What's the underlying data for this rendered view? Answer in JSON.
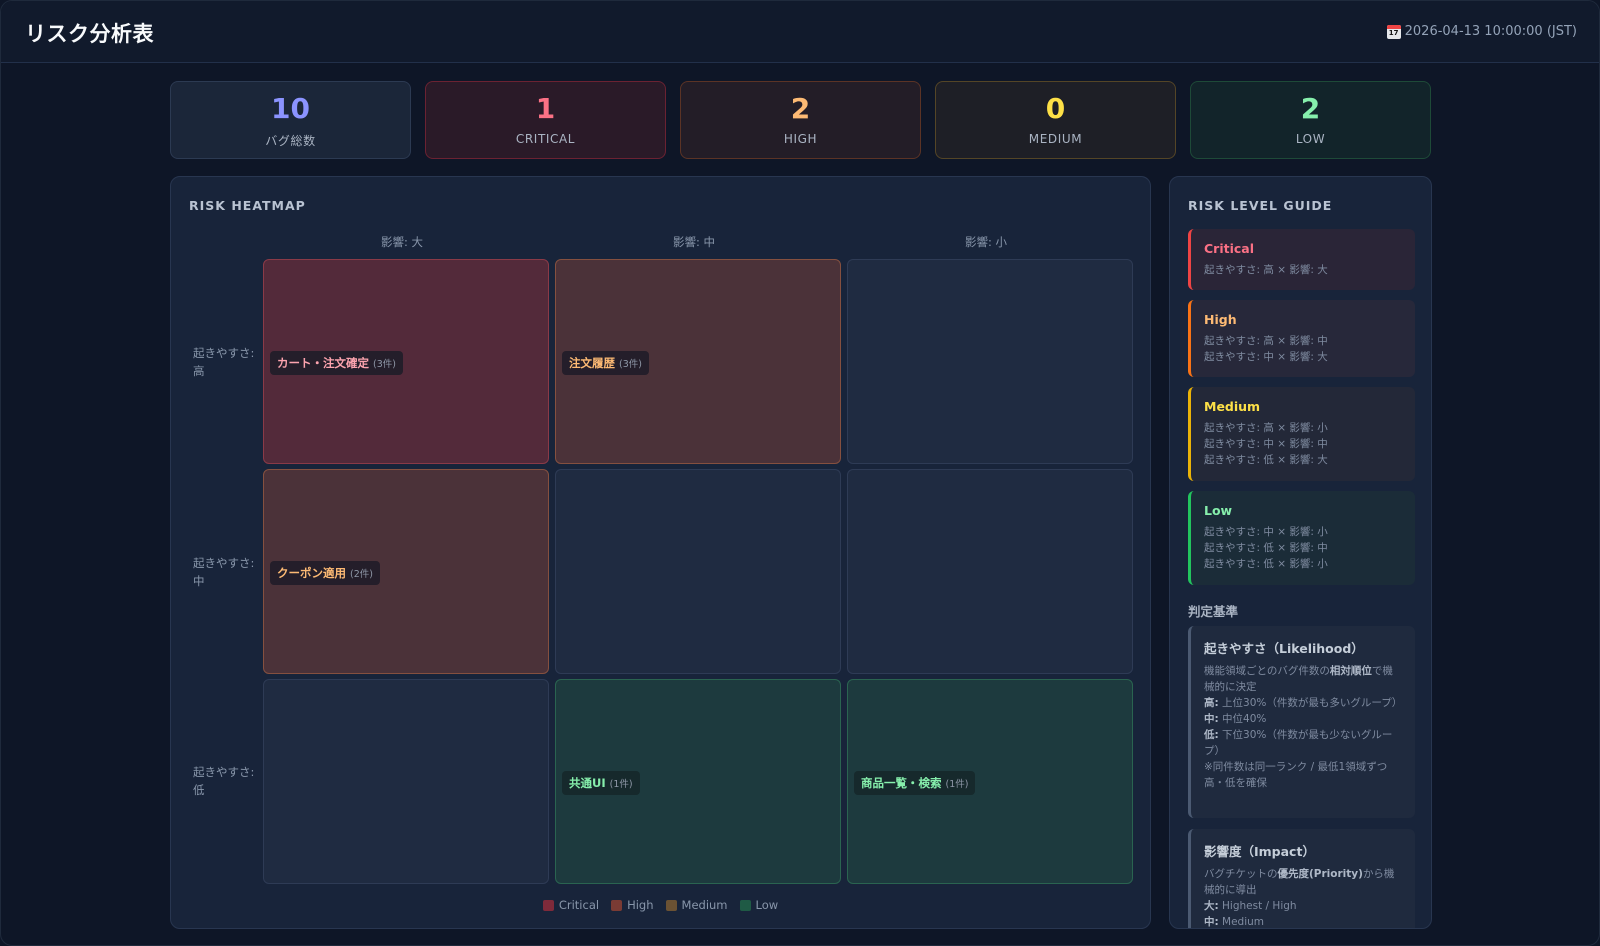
{
  "header": {
    "title": "リスク分析表",
    "timestamp": "2026-04-13 10:00:00 (JST)",
    "timestamp_icon": "calendar-icon"
  },
  "stats": {
    "total": {
      "value": "10",
      "label": "バグ総数"
    },
    "critical": {
      "value": "1",
      "label": "CRITICAL"
    },
    "high": {
      "value": "2",
      "label": "HIGH"
    },
    "medium": {
      "value": "0",
      "label": "MEDIUM"
    },
    "low": {
      "value": "2",
      "label": "LOW"
    }
  },
  "heatmap": {
    "title": "RISK HEATMAP",
    "columns": [
      "影響: 大",
      "影響: 中",
      "影響: 小"
    ],
    "rows": [
      {
        "label_1": "起きやすさ:",
        "label_2": "高"
      },
      {
        "label_1": "起きやすさ:",
        "label_2": "中"
      },
      {
        "label_1": "起きやすさ:",
        "label_2": "低"
      }
    ],
    "cells": {
      "high_large": {
        "name": "カート・注文確定",
        "count": "(3件)",
        "level": "critical"
      },
      "high_mid": {
        "name": "注文履歴",
        "count": "(3件)",
        "level": "high"
      },
      "mid_large": {
        "name": "クーポン適用",
        "count": "(2件)",
        "level": "high"
      },
      "low_mid": {
        "name": "共通UI",
        "count": "(1件)",
        "level": "low"
      },
      "low_small": {
        "name": "商品一覧・検索",
        "count": "(1件)",
        "level": "low"
      }
    },
    "legend": [
      {
        "label": "Critical",
        "color": "#7f2a3a"
      },
      {
        "label": "High",
        "color": "#7a3b34"
      },
      {
        "label": "Medium",
        "color": "#6b5233"
      },
      {
        "label": "Low",
        "color": "#1f5a45"
      }
    ]
  },
  "guide": {
    "title": "RISK LEVEL GUIDE",
    "critical": {
      "title": "Critical",
      "lines": [
        "起きやすさ: 高 × 影響: 大"
      ]
    },
    "high": {
      "title": "High",
      "lines": [
        "起きやすさ: 高 × 影響: 中",
        "起きやすさ: 中 × 影響: 大"
      ]
    },
    "medium": {
      "title": "Medium",
      "lines": [
        "起きやすさ: 高 × 影響: 小",
        "起きやすさ: 中 × 影響: 中",
        "起きやすさ: 低 × 影響: 大"
      ]
    },
    "low": {
      "title": "Low",
      "lines": [
        "起きやすさ: 中 × 影響: 小",
        "起きやすさ: 低 × 影響: 中",
        "起きやすさ: 低 × 影響: 小"
      ]
    },
    "criteria_title": "判定基準",
    "likelihood": {
      "title": "起きやすさ（Likelihood）",
      "desc_pre": "機能領域ごとのバグ件数の",
      "desc_bold": "相対順位",
      "desc_post": "で機械的に決定",
      "high_key": "高:",
      "high_val": " 上位30%（件数が最も多いグループ）",
      "mid_key": "中:",
      "mid_val": " 中位40%",
      "low_key": "低:",
      "low_val": " 下位30%（件数が最も少ないグループ）",
      "note": "※同件数は同一ランク / 最低1領域ずつ高・低を確保"
    },
    "impact": {
      "title": "影響度（Impact）",
      "desc_pre": "バグチケットの",
      "desc_bold": "優先度(Priority)",
      "desc_post": "から機械的に導出",
      "large_key": "大:",
      "large_val": " Highest / High",
      "mid_key": "中:",
      "mid_val": " Medium"
    }
  }
}
